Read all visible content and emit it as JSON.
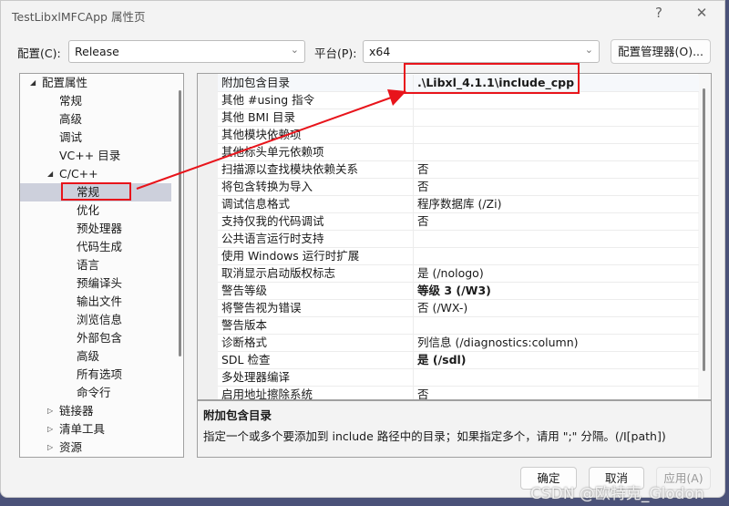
{
  "window": {
    "title": "TestLibxlMFCApp 属性页",
    "help": "?",
    "close": "✕"
  },
  "toolbar": {
    "config_label": "配置(C):",
    "config_value": "Release",
    "platform_label": "平台(P):",
    "platform_value": "x64",
    "config_manager": "配置管理器(O)..."
  },
  "tree": [
    {
      "label": "配置属性",
      "level": 0,
      "expand": "expanded"
    },
    {
      "label": "常规",
      "level": 1
    },
    {
      "label": "高级",
      "level": 1
    },
    {
      "label": "调试",
      "level": 1
    },
    {
      "label": "VC++ 目录",
      "level": 1
    },
    {
      "label": "C/C++",
      "level": 1,
      "expand": "expanded"
    },
    {
      "label": "常规",
      "level": 2,
      "selected": true
    },
    {
      "label": "优化",
      "level": 2
    },
    {
      "label": "预处理器",
      "level": 2
    },
    {
      "label": "代码生成",
      "level": 2
    },
    {
      "label": "语言",
      "level": 2
    },
    {
      "label": "预编译头",
      "level": 2
    },
    {
      "label": "输出文件",
      "level": 2
    },
    {
      "label": "浏览信息",
      "level": 2
    },
    {
      "label": "外部包含",
      "level": 2
    },
    {
      "label": "高级",
      "level": 2
    },
    {
      "label": "所有选项",
      "level": 2
    },
    {
      "label": "命令行",
      "level": 2
    },
    {
      "label": "链接器",
      "level": 1,
      "expand": "collapsed"
    },
    {
      "label": "清单工具",
      "level": 1,
      "expand": "collapsed"
    },
    {
      "label": "资源",
      "level": 1,
      "expand": "collapsed"
    }
  ],
  "properties": [
    {
      "name": "附加包含目录",
      "value": ".\\Libxl_4.1.1\\include_cpp",
      "bold": true
    },
    {
      "name": "其他 #using 指令",
      "value": ""
    },
    {
      "name": "其他 BMI 目录",
      "value": ""
    },
    {
      "name": "其他模块依赖项",
      "value": ""
    },
    {
      "name": "其他标头单元依赖项",
      "value": ""
    },
    {
      "name": "扫描源以查找模块依赖关系",
      "value": "否"
    },
    {
      "name": "将包含转换为导入",
      "value": "否"
    },
    {
      "name": "调试信息格式",
      "value": "程序数据库 (/Zi)"
    },
    {
      "name": "支持仅我的代码调试",
      "value": "否"
    },
    {
      "name": "公共语言运行时支持",
      "value": ""
    },
    {
      "name": "使用 Windows 运行时扩展",
      "value": ""
    },
    {
      "name": "取消显示启动版权标志",
      "value": "是 (/nologo)"
    },
    {
      "name": "警告等级",
      "value": "等级 3 (/W3)",
      "bold": true
    },
    {
      "name": "将警告视为错误",
      "value": "否 (/WX-)"
    },
    {
      "name": "警告版本",
      "value": ""
    },
    {
      "name": "诊断格式",
      "value": "列信息 (/diagnostics:column)"
    },
    {
      "name": "SDL 检查",
      "value": "是 (/sdl)",
      "bold": true
    },
    {
      "name": "多处理器编译",
      "value": ""
    },
    {
      "name": "启用地址擦除系统",
      "value": "否"
    }
  ],
  "description": {
    "title": "附加包含目录",
    "text": "指定一个或多个要添加到 include 路径中的目录；如果指定多个，请用 \";\" 分隔。(/I[path])"
  },
  "buttons": {
    "ok": "确定",
    "cancel": "取消",
    "apply": "应用(A)"
  },
  "watermark": "CSDN @欧特克_Glodon",
  "annotation_color": "#e8141b"
}
